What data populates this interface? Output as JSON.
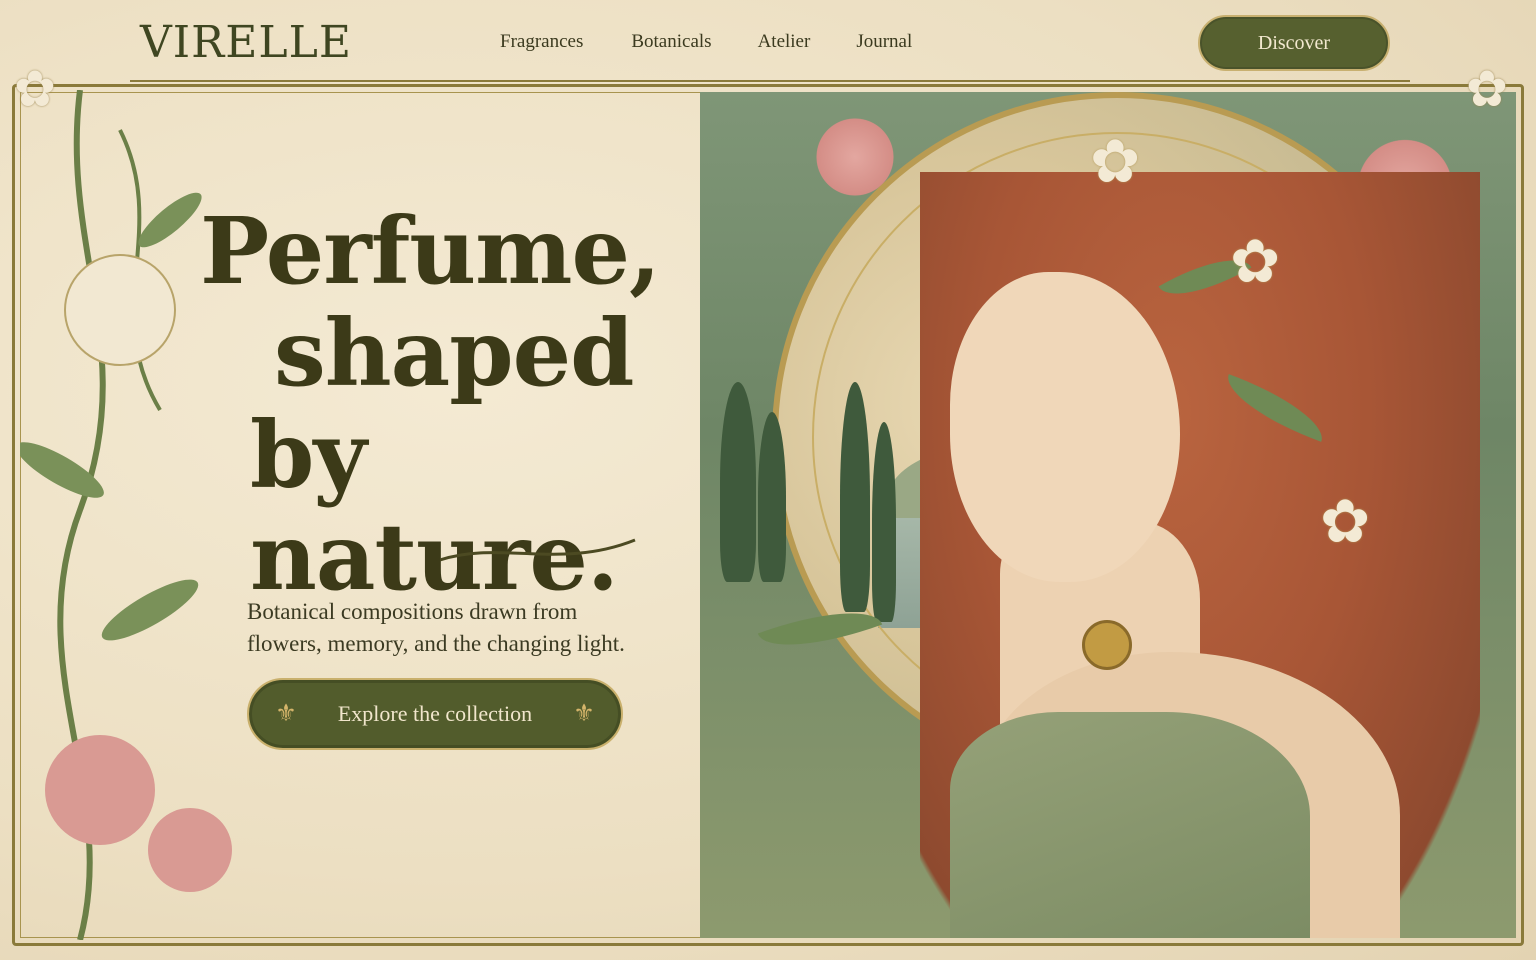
{
  "brand": {
    "logo_text": "VIRELLE"
  },
  "nav": {
    "items": [
      {
        "label": "Fragrances"
      },
      {
        "label": "Botanicals"
      },
      {
        "label": "Atelier"
      },
      {
        "label": "Journal"
      }
    ],
    "discover_label": "Discover"
  },
  "hero": {
    "headline_line1": "Perfume,",
    "headline_line2": "shaped",
    "headline_line3": "by nature.",
    "subtitle_line1": "Botanical compositions drawn from",
    "subtitle_line2": "flowers, memory, and the changing light.",
    "cta_label": "Explore the collection"
  },
  "colors": {
    "accent_green": "#525c2c",
    "gold_trim": "#c9b06c",
    "parchment": "#efe3c8",
    "hair": "#a85636",
    "text_dark": "#3c3a18"
  },
  "icons": {
    "cta_left": "fleur-de-lis-icon",
    "cta_right": "fleur-de-lis-icon"
  }
}
